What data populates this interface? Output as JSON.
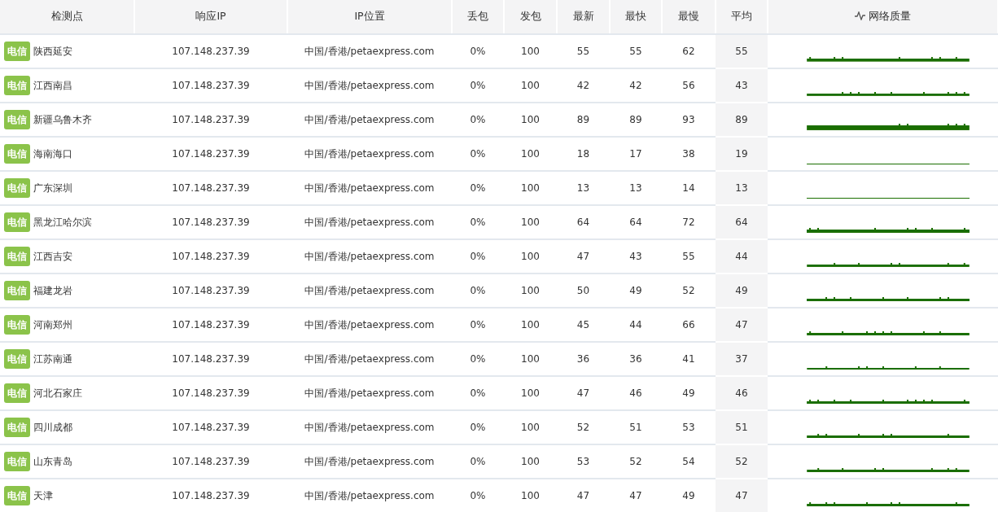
{
  "table": {
    "columns": [
      "检测点",
      "响应IP",
      "IP位置",
      "丢包",
      "发包",
      "最新",
      "最快",
      "最慢",
      "平均",
      "网络质量"
    ],
    "rows": [
      {
        "isp": "电信",
        "node": "陕西延安",
        "ip": "107.148.237.39",
        "location": "中国/香港/petaexpress.com",
        "loss": "0%",
        "sent": "100",
        "latest": "55",
        "fastest": "55",
        "slowest": "62",
        "average": "55"
      },
      {
        "isp": "电信",
        "node": "江西南昌",
        "ip": "107.148.237.39",
        "location": "中国/香港/petaexpress.com",
        "loss": "0%",
        "sent": "100",
        "latest": "42",
        "fastest": "42",
        "slowest": "56",
        "average": "43"
      },
      {
        "isp": "电信",
        "node": "新疆乌鲁木齐",
        "ip": "107.148.237.39",
        "location": "中国/香港/petaexpress.com",
        "loss": "0%",
        "sent": "100",
        "latest": "89",
        "fastest": "89",
        "slowest": "93",
        "average": "89"
      },
      {
        "isp": "电信",
        "node": "海南海口",
        "ip": "107.148.237.39",
        "location": "中国/香港/petaexpress.com",
        "loss": "0%",
        "sent": "100",
        "latest": "18",
        "fastest": "17",
        "slowest": "38",
        "average": "19"
      },
      {
        "isp": "电信",
        "node": "广东深圳",
        "ip": "107.148.237.39",
        "location": "中国/香港/petaexpress.com",
        "loss": "0%",
        "sent": "100",
        "latest": "13",
        "fastest": "13",
        "slowest": "14",
        "average": "13"
      },
      {
        "isp": "电信",
        "node": "黑龙江哈尔滨",
        "ip": "107.148.237.39",
        "location": "中国/香港/petaexpress.com",
        "loss": "0%",
        "sent": "100",
        "latest": "64",
        "fastest": "64",
        "slowest": "72",
        "average": "64"
      },
      {
        "isp": "电信",
        "node": "江西吉安",
        "ip": "107.148.237.39",
        "location": "中国/香港/petaexpress.com",
        "loss": "0%",
        "sent": "100",
        "latest": "47",
        "fastest": "43",
        "slowest": "55",
        "average": "44"
      },
      {
        "isp": "电信",
        "node": "福建龙岩",
        "ip": "107.148.237.39",
        "location": "中国/香港/petaexpress.com",
        "loss": "0%",
        "sent": "100",
        "latest": "50",
        "fastest": "49",
        "slowest": "52",
        "average": "49"
      },
      {
        "isp": "电信",
        "node": "河南郑州",
        "ip": "107.148.237.39",
        "location": "中国/香港/petaexpress.com",
        "loss": "0%",
        "sent": "100",
        "latest": "45",
        "fastest": "44",
        "slowest": "66",
        "average": "47"
      },
      {
        "isp": "电信",
        "node": "江苏南通",
        "ip": "107.148.237.39",
        "location": "中国/香港/petaexpress.com",
        "loss": "0%",
        "sent": "100",
        "latest": "36",
        "fastest": "36",
        "slowest": "41",
        "average": "37"
      },
      {
        "isp": "电信",
        "node": "河北石家庄",
        "ip": "107.148.237.39",
        "location": "中国/香港/petaexpress.com",
        "loss": "0%",
        "sent": "100",
        "latest": "47",
        "fastest": "46",
        "slowest": "49",
        "average": "46"
      },
      {
        "isp": "电信",
        "node": "四川成都",
        "ip": "107.148.237.39",
        "location": "中国/香港/petaexpress.com",
        "loss": "0%",
        "sent": "100",
        "latest": "52",
        "fastest": "51",
        "slowest": "53",
        "average": "51"
      },
      {
        "isp": "电信",
        "node": "山东青岛",
        "ip": "107.148.237.39",
        "location": "中国/香港/petaexpress.com",
        "loss": "0%",
        "sent": "100",
        "latest": "53",
        "fastest": "52",
        "slowest": "54",
        "average": "52"
      },
      {
        "isp": "电信",
        "node": "天津",
        "ip": "107.148.237.39",
        "location": "中国/香港/petaexpress.com",
        "loss": "0%",
        "sent": "100",
        "latest": "47",
        "fastest": "47",
        "slowest": "49",
        "average": "47"
      }
    ]
  }
}
